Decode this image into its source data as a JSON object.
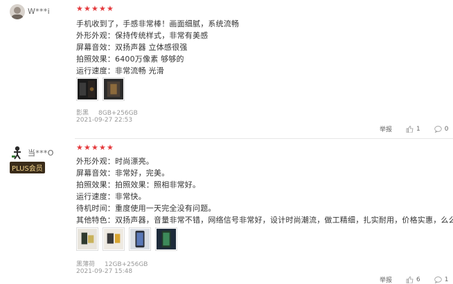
{
  "reviews": [
    {
      "username": "W***i",
      "plus_badge": "",
      "rating": 5,
      "lines": [
        "手机收到了，手感非常棒！画面细腻，系统流畅",
        "外形外观：保持传统样式，非常有美感",
        "屏幕音效：双扬声器 立体感很强",
        "拍照效果：6400万像素 够够的",
        "运行速度：非常流畅 光滑"
      ],
      "photo_count": 2,
      "variant_color": "影黑",
      "variant_spec": "8GB+256GB",
      "timestamp": "2021-09-27 22:53",
      "report_label": "举报",
      "likes": "1",
      "comments": "0"
    },
    {
      "username": "当***O",
      "plus_badge": "PLUS会员",
      "rating": 5,
      "lines": [
        "外形外观：时尚漂亮。",
        "屏幕音效：非常好，完美。",
        "拍照效果：拍照效果：照相非常好。",
        "运行速度：非常快。",
        "待机时间：重度使用一天完全没有问题。",
        "其他特色：双扬声器，音量非常不错，网络信号非常好，设计时尚潮流，做工精细，扎实耐用，价格实惠，么么哒！"
      ],
      "photo_count": 4,
      "variant_color": "黑薄荷",
      "variant_spec": "12GB+256GB",
      "timestamp": "2021-09-27 15:48",
      "report_label": "举报",
      "likes": "6",
      "comments": "1"
    }
  ],
  "colors": {
    "star": "#e4393c",
    "plus_bg": "#3a2c1a",
    "plus_fg": "#f2d38a",
    "meta": "#999999"
  },
  "icons": {
    "like": "thumbs-up-icon",
    "comment": "comment-bubble-icon",
    "star": "star-icon"
  }
}
